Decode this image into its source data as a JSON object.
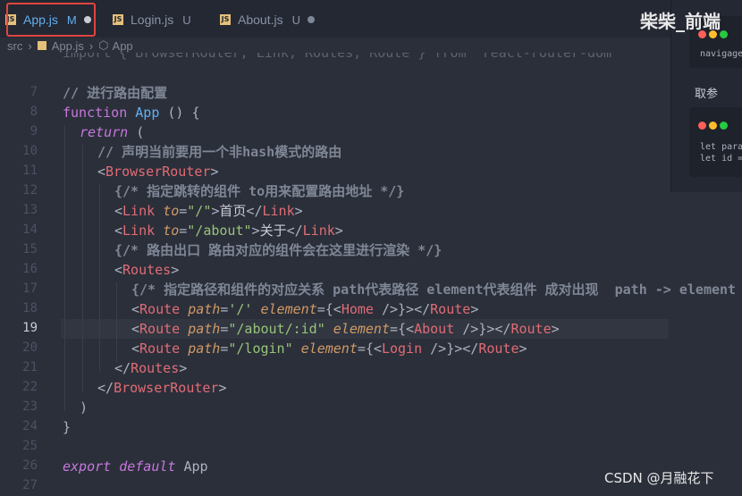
{
  "tabs": [
    {
      "label": "App.js",
      "flag": "M"
    },
    {
      "label": "Login.js",
      "flag": "U"
    },
    {
      "label": "About.js",
      "flag": "U"
    }
  ],
  "watermark_top": "柴柴_前端",
  "breadcrumb": {
    "folder": "src",
    "file": "App.js",
    "symbol": "App"
  },
  "line_numbers": [
    "",
    "7",
    "8",
    "9",
    "10",
    "11",
    "12",
    "13",
    "14",
    "15",
    "16",
    "17",
    "18",
    "19",
    "20",
    "21",
    "22",
    "23",
    "24",
    "25",
    "26",
    "27"
  ],
  "current_line": "19",
  "code": {
    "l0": "import { BrowserRouter, Link, Routes, Route } from 'react-router-dom'",
    "l2": "// 进行路由配置",
    "l3_kw": "function",
    "l3_fn": "App",
    "l3_rest": " () {",
    "l4_kw": "return",
    "l4_rest": " (",
    "l5": "// 声明当前要用一个非hash模式的路由",
    "l6_tag": "BrowserRouter",
    "l7": "{/* 指定跳转的组件 to用来配置路由地址 */}",
    "l8_tag": "Link",
    "l8_attr": "to",
    "l8_str": "\"/\"",
    "l8_text": "首页",
    "l9_attr": "to",
    "l9_str": "\"/about\"",
    "l9_text": "关于",
    "l10": "{/* 路由出口 路由对应的组件会在这里进行渲染 */}",
    "l11_tag": "Routes",
    "l12": "{/* 指定路径和组件的对应关系 path代表路径 element代表组件 成对出现  path -> element */}",
    "l13_path": "'/'",
    "l13_comp": "Home",
    "l14_path": "\"/about/:id\"",
    "l14_comp": "About",
    "l15_path": "\"/login\"",
    "l15_comp": "Login",
    "l16_tag": "Routes",
    "l17_tag": "BrowserRouter",
    "l18": ")",
    "l19": "}",
    "l21_kw1": "export",
    "l21_kw2": "default",
    "l21_name": "App",
    "route_tag": "Route",
    "attr_path": "path",
    "attr_element": "element"
  },
  "panel": {
    "snippet1": "navigage",
    "heading": "取参",
    "snippet2": "let para\nlet id ="
  },
  "footer_mark": "CSDN @月融花下",
  "colors": {
    "keyword": "#c678dd",
    "function": "#61afef",
    "tag": "#e06c75",
    "attr": "#d19a66",
    "string": "#98c379",
    "highlight_box": "#e0443e"
  }
}
